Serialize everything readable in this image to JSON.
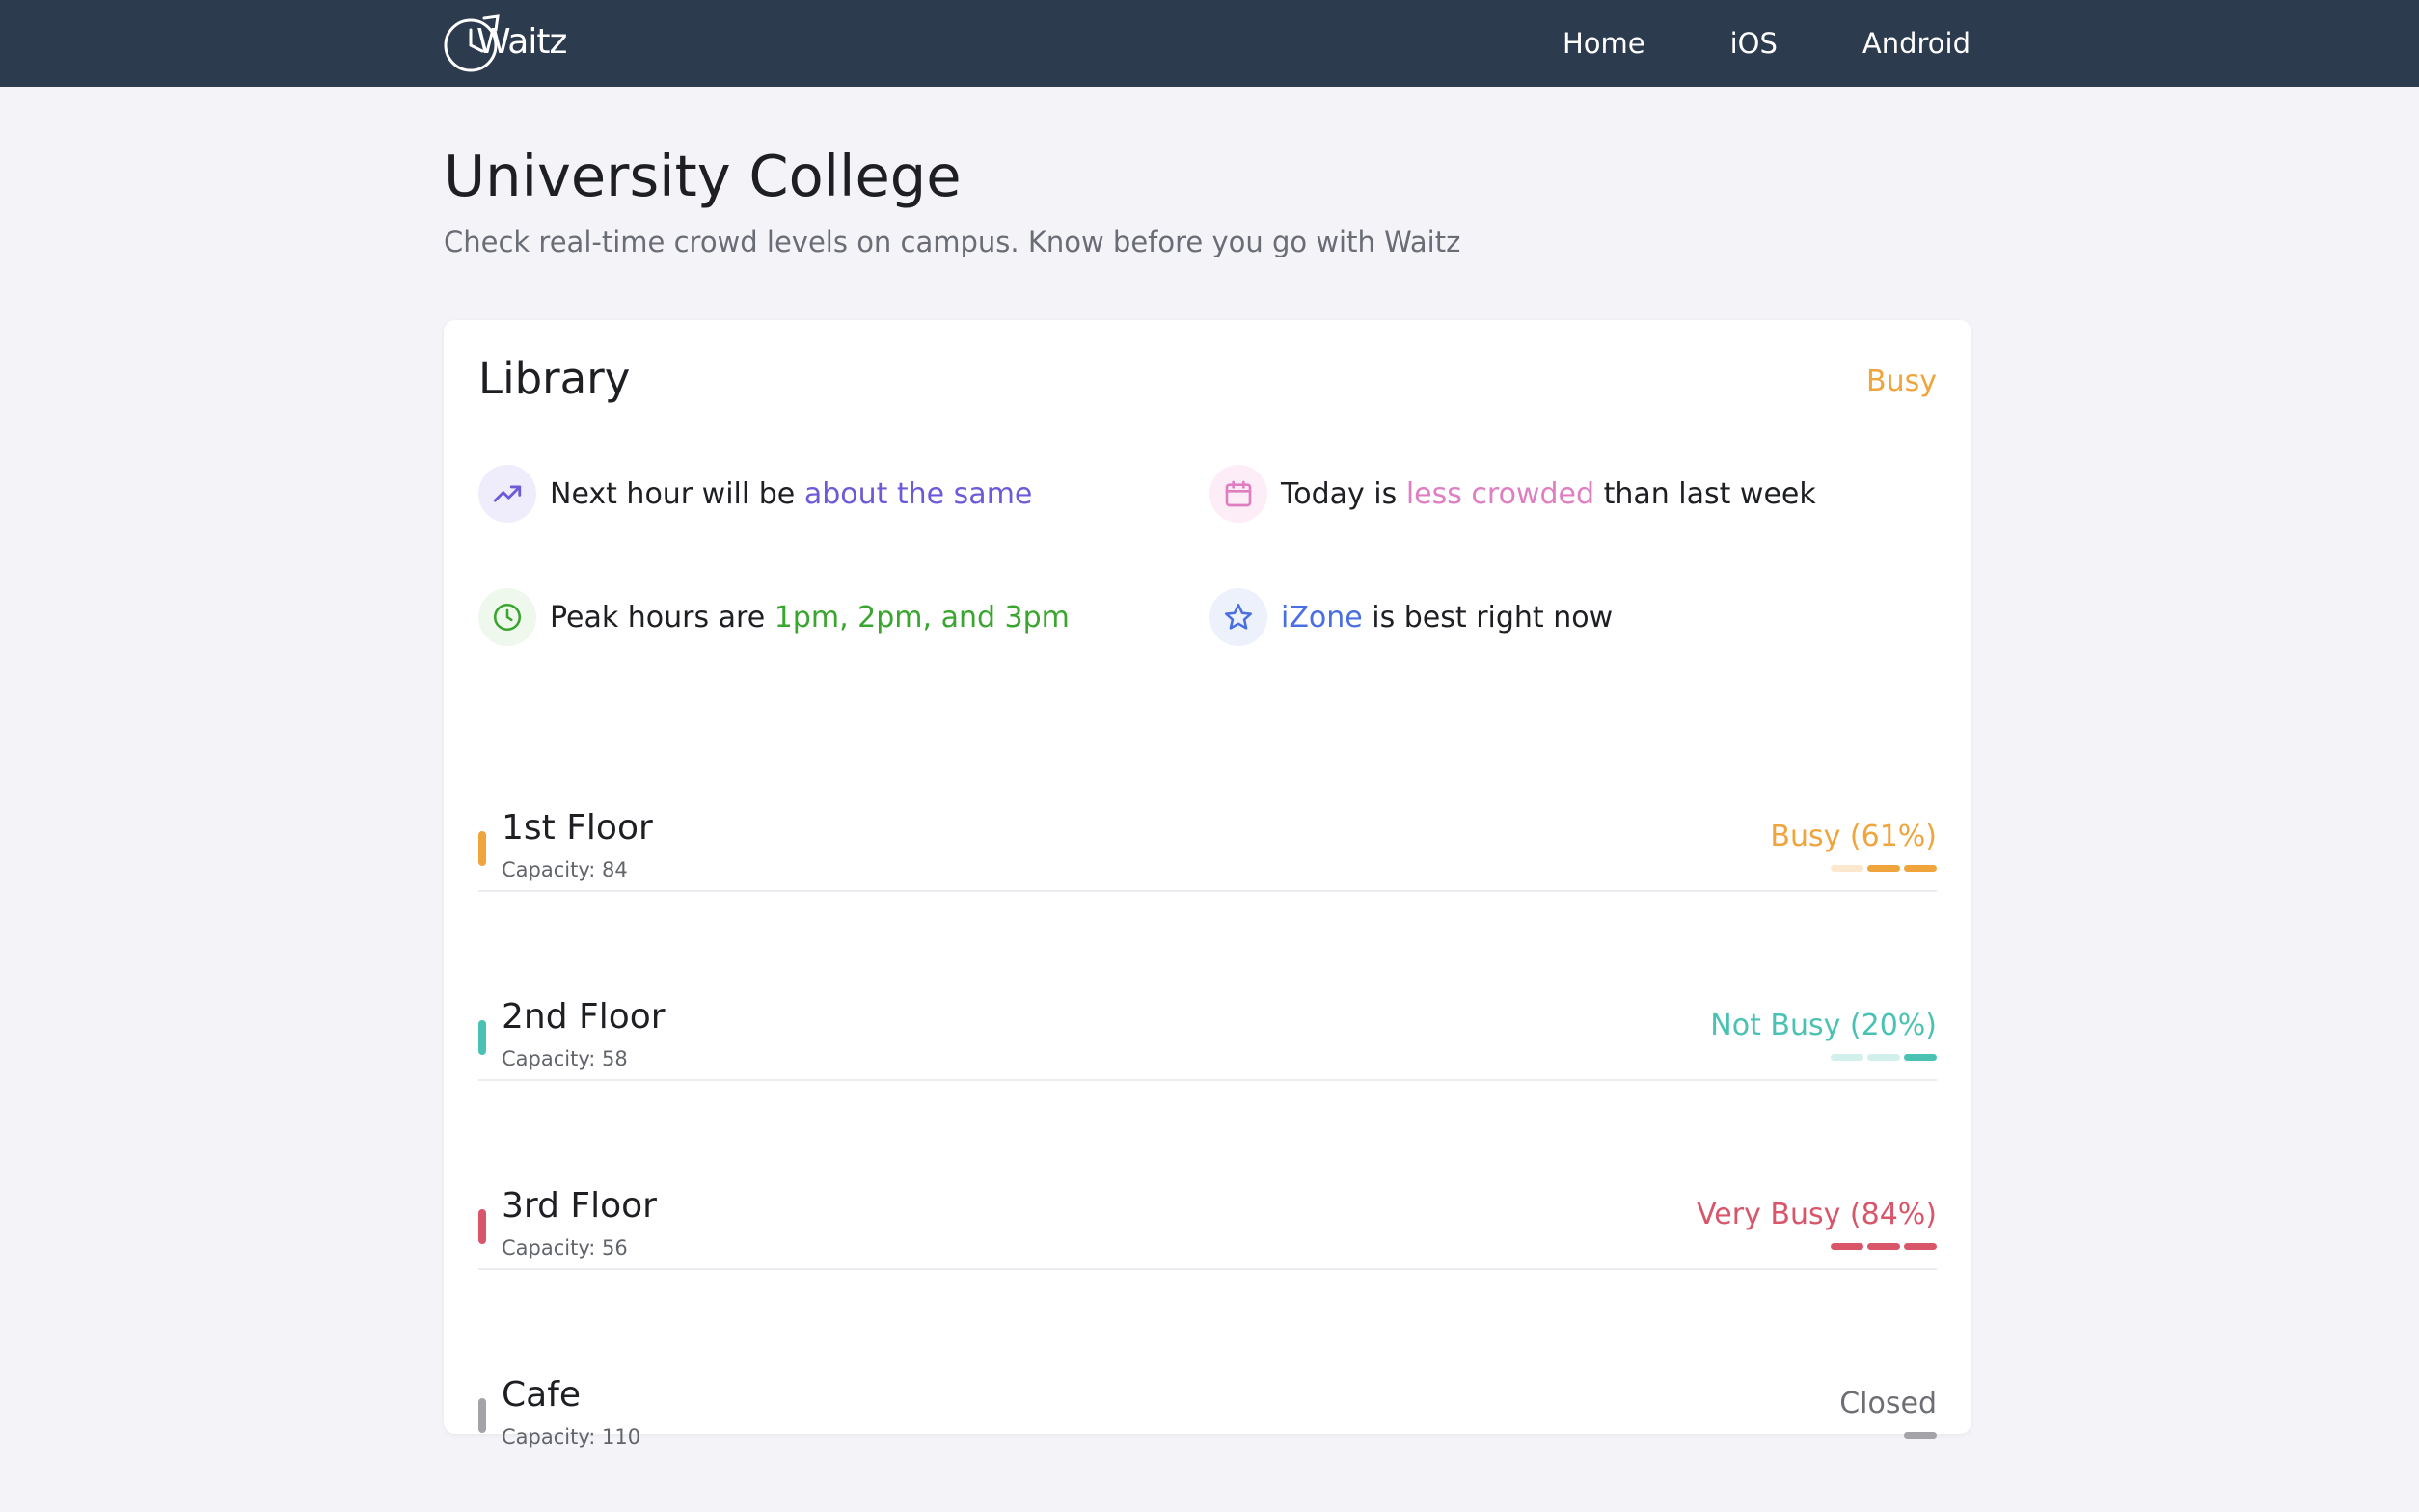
{
  "header": {
    "logo_text": "Waitz",
    "nav": [
      "Home",
      "iOS",
      "Android"
    ]
  },
  "page": {
    "title": "University College",
    "subtitle": "Check real-time crowd levels on campus. Know before you go with Waitz"
  },
  "card": {
    "title": "Library",
    "status": "Busy",
    "status_color": "#efa43c",
    "insights": {
      "next_hour": {
        "icon": "trending-up-icon",
        "prefix": "Next hour will be ",
        "highlight": "about the same",
        "suffix": "",
        "color": "#6c5bd8"
      },
      "today": {
        "icon": "calendar-icon",
        "prefix": "Today is ",
        "highlight": "less crowded",
        "suffix": " than last week",
        "color": "#e07ec2"
      },
      "peak": {
        "icon": "clock-icon",
        "prefix": "Peak hours are ",
        "highlight": "1pm, 2pm, and 3pm",
        "suffix": "",
        "color": "#3aa52f"
      },
      "best": {
        "icon": "star-icon",
        "prefix": "",
        "highlight": "iZone",
        "suffix": " is best right now",
        "color": "#4a6fe0"
      }
    },
    "floors": [
      {
        "name": "1st Floor",
        "capacity": "Capacity: 84",
        "status": "Busy (61%)",
        "percent": 61,
        "color": "#efa43c",
        "meter_filled": 2,
        "meter_total": 3
      },
      {
        "name": "2nd Floor",
        "capacity": "Capacity: 58",
        "status": "Not Busy (20%)",
        "percent": 20,
        "color": "#49c2b3",
        "meter_filled": 1,
        "meter_total": 3
      },
      {
        "name": "3rd Floor",
        "capacity": "Capacity: 56",
        "status": "Very Busy (84%)",
        "percent": 84,
        "color": "#d8556a",
        "meter_filled": 3,
        "meter_total": 3
      },
      {
        "name": "Cafe",
        "capacity": "Capacity: 110",
        "status": "Closed",
        "percent": null,
        "color": "#a3a3a8",
        "meter_filled": 1,
        "meter_total": 1
      }
    ]
  }
}
